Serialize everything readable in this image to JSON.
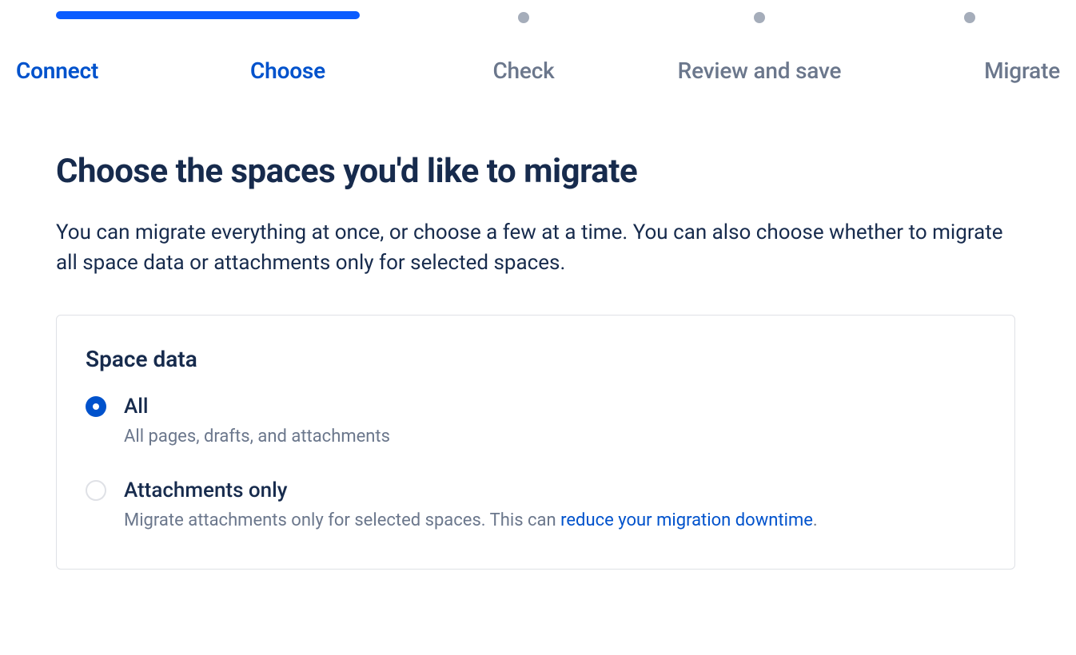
{
  "stepper": {
    "steps": [
      {
        "label": "Connect",
        "state": "completed"
      },
      {
        "label": "Choose",
        "state": "current"
      },
      {
        "label": "Check",
        "state": "future"
      },
      {
        "label": "Review and save",
        "state": "future"
      },
      {
        "label": "Migrate",
        "state": "future"
      }
    ]
  },
  "page": {
    "title": "Choose the spaces you'd like to migrate",
    "description": "You can migrate everything at once, or choose a few at a time. You can also choose whether to migrate all space data or attachments only for selected spaces."
  },
  "panel": {
    "heading": "Space data",
    "options": [
      {
        "id": "all",
        "label": "All",
        "description": "All pages, drafts, and attachments",
        "selected": true
      },
      {
        "id": "attachments-only",
        "label": "Attachments only",
        "description_prefix": "Migrate attachments only for selected spaces. This can ",
        "description_link": "reduce your migration downtime",
        "description_suffix": ".",
        "selected": false
      }
    ]
  }
}
